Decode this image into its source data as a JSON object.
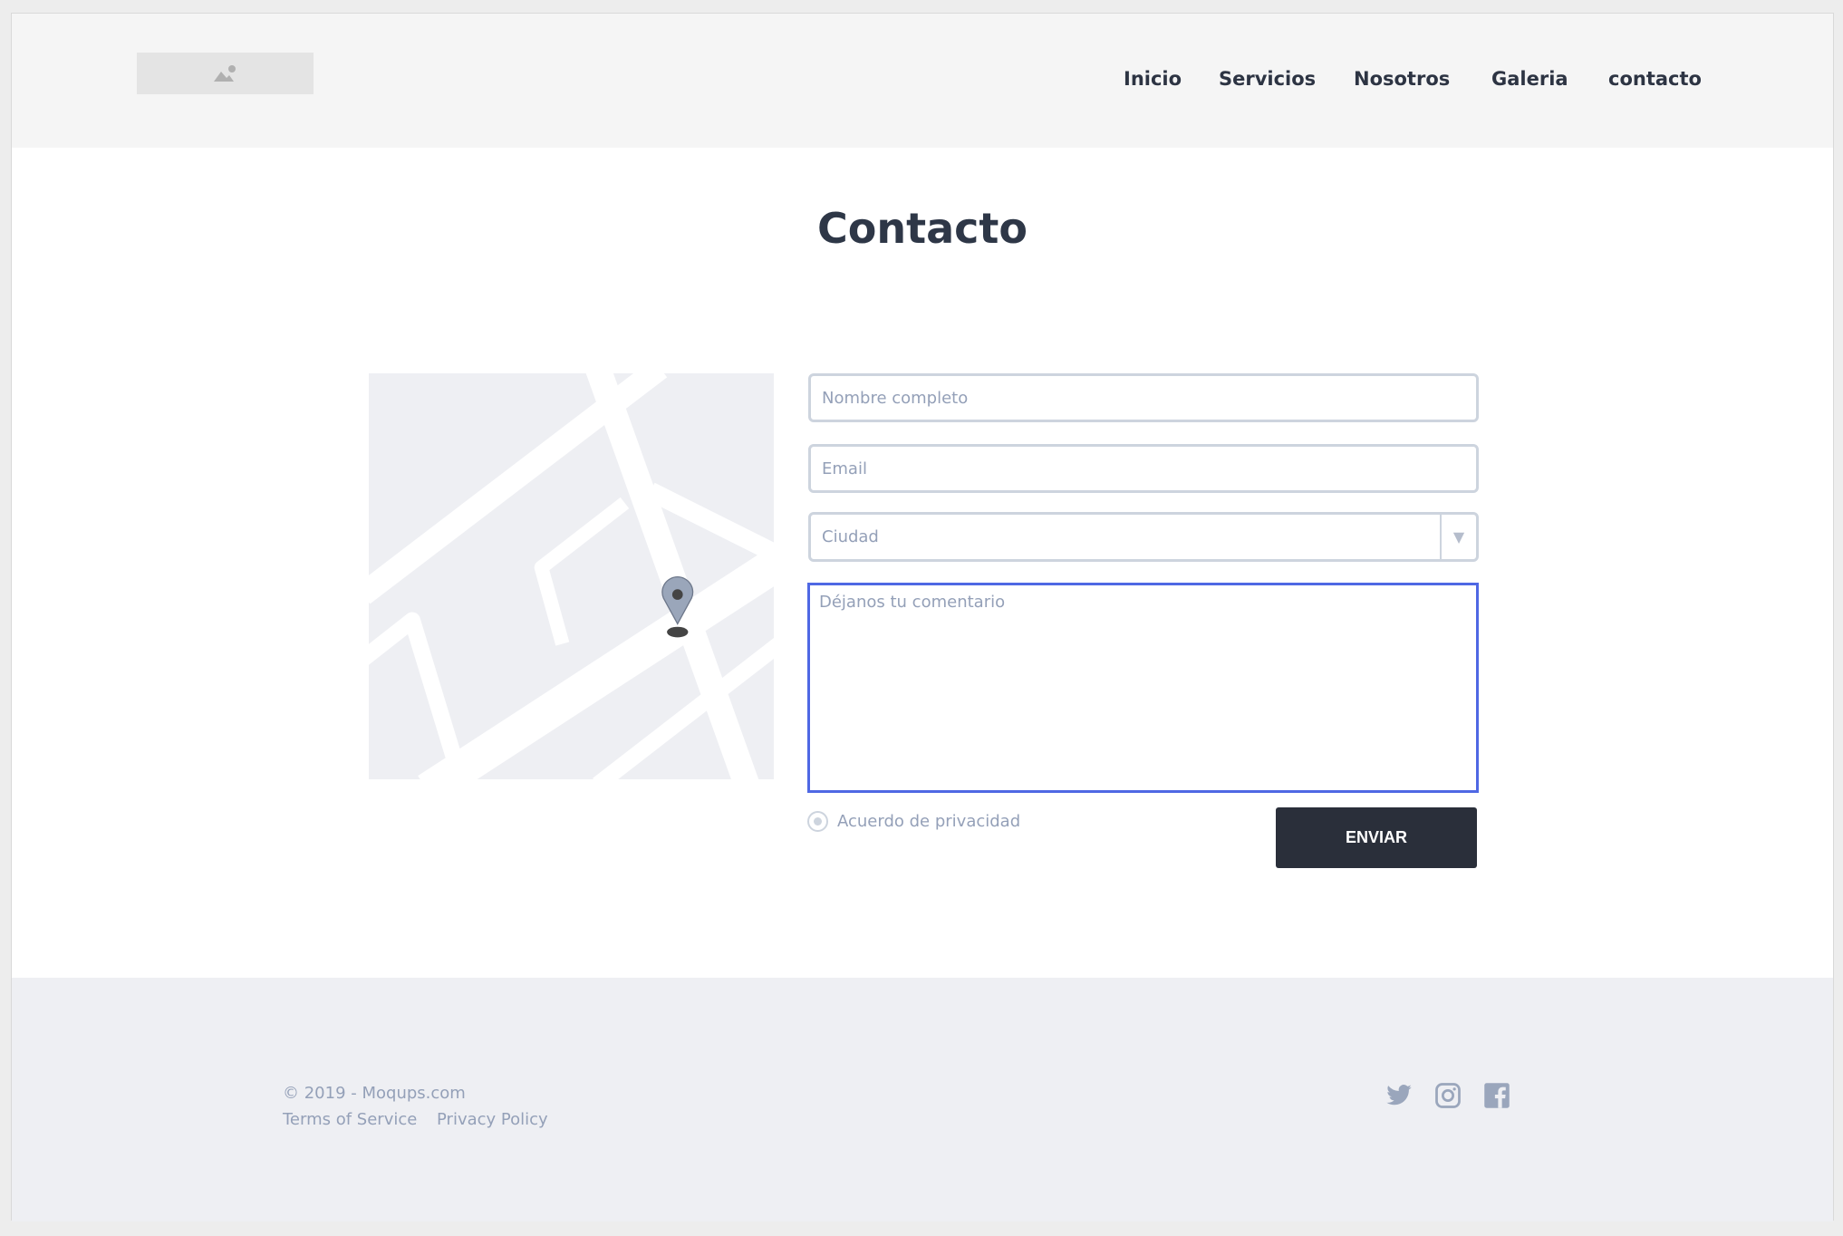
{
  "header": {
    "logo_icon": "image-placeholder-icon",
    "nav": [
      "Inicio",
      "Servicios",
      "Nosotros",
      "Galeria",
      "contacto"
    ]
  },
  "main": {
    "title": "Contacto",
    "map": {
      "pin_icon": "map-pin-icon"
    },
    "form": {
      "name_placeholder": "Nombre completo",
      "email_placeholder": "Email",
      "city_placeholder": "Ciudad",
      "comment_placeholder": "Déjanos tu comentario",
      "privacy_label": "Acuerdo de privacidad",
      "submit_label": "ENVIAR"
    }
  },
  "footer": {
    "copyright": "© 2019 - Moqups.com",
    "links": [
      "Terms of Service",
      "Privacy Policy"
    ],
    "social": [
      "twitter-icon",
      "instagram-icon",
      "facebook-icon"
    ]
  },
  "colors": {
    "accent": "#4f68e4",
    "button": "#2a2f3a",
    "text": "#2e3747",
    "muted": "#94a0b8"
  }
}
